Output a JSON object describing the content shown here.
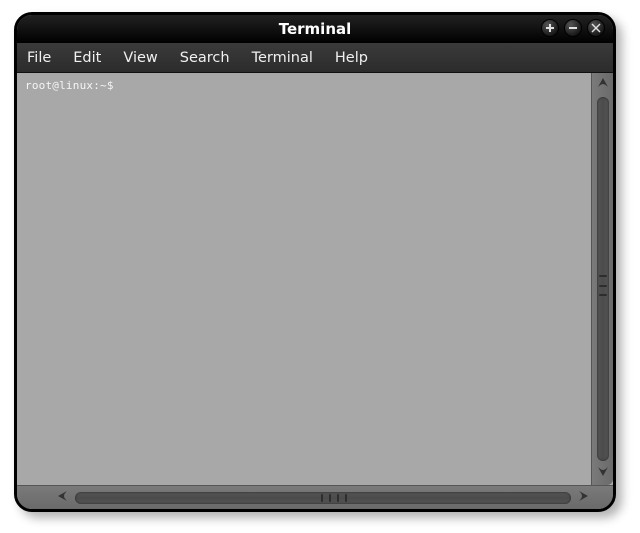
{
  "window": {
    "title": "Terminal"
  },
  "menubar": {
    "items": [
      "File",
      "Edit",
      "View",
      "Search",
      "Terminal",
      "Help"
    ]
  },
  "terminal": {
    "prompt": "root@linux:~$"
  }
}
